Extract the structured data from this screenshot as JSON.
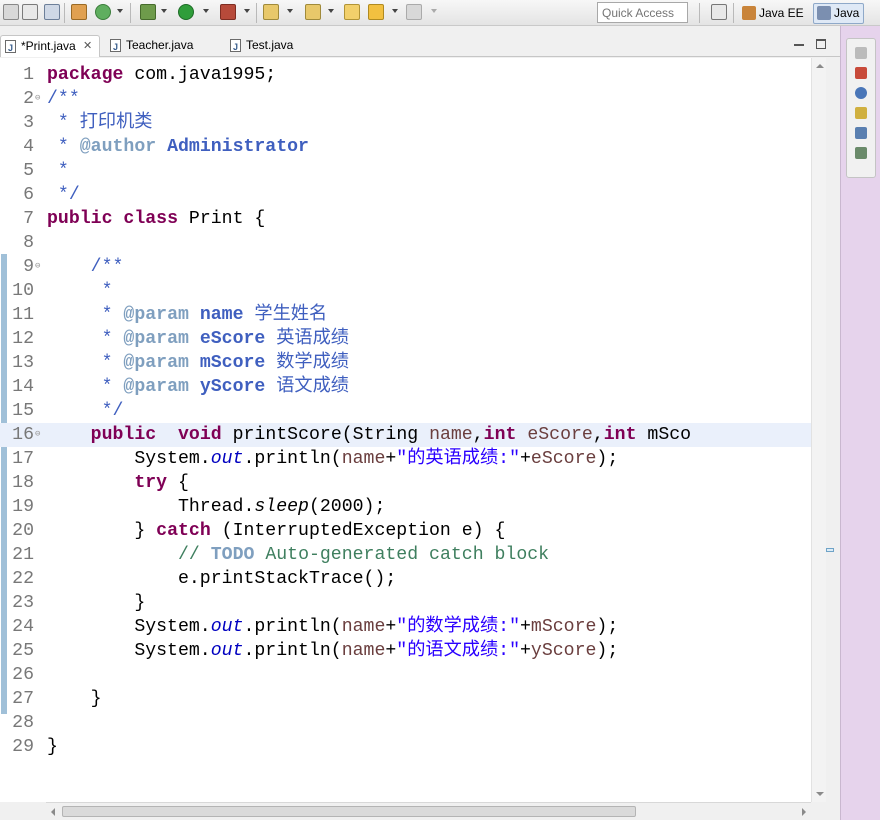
{
  "toolbar": {
    "quick_access_placeholder": "Quick Access",
    "perspectives": [
      {
        "label": "Java EE"
      },
      {
        "label": "Java"
      }
    ]
  },
  "tabs": [
    {
      "label": "*Print.java",
      "active": true
    },
    {
      "label": "Teacher.java",
      "active": false
    },
    {
      "label": "Test.java",
      "active": false
    }
  ],
  "editor": {
    "highlight_line": 16,
    "lines": [
      {
        "n": "1",
        "t": "package com.java1995;"
      },
      {
        "n": "2",
        "t": "/**"
      },
      {
        "n": "3",
        "t": " * 打印机类"
      },
      {
        "n": "4",
        "t": " * @author Administrator"
      },
      {
        "n": "5",
        "t": " *"
      },
      {
        "n": "6",
        "t": " */"
      },
      {
        "n": "7",
        "t": "public class Print {"
      },
      {
        "n": "8",
        "t": ""
      },
      {
        "n": "9",
        "t": "    /**"
      },
      {
        "n": "10",
        "t": "     *"
      },
      {
        "n": "11",
        "t": "     * @param name 学生姓名"
      },
      {
        "n": "12",
        "t": "     * @param eScore 英语成绩"
      },
      {
        "n": "13",
        "t": "     * @param mScore 数学成绩"
      },
      {
        "n": "14",
        "t": "     * @param yScore 语文成绩"
      },
      {
        "n": "15",
        "t": "     */"
      },
      {
        "n": "16",
        "t": "    public  void printScore(String name,int eScore,int mSco"
      },
      {
        "n": "17",
        "t": "        System.out.println(name+\"的英语成绩:\"+eScore);"
      },
      {
        "n": "18",
        "t": "        try {"
      },
      {
        "n": "19",
        "t": "            Thread.sleep(2000);"
      },
      {
        "n": "20",
        "t": "        } catch (InterruptedException e) {"
      },
      {
        "n": "21",
        "t": "            // TODO Auto-generated catch block"
      },
      {
        "n": "22",
        "t": "            e.printStackTrace();"
      },
      {
        "n": "23",
        "t": "        }"
      },
      {
        "n": "24",
        "t": "        System.out.println(name+\"的数学成绩:\"+mScore);"
      },
      {
        "n": "25",
        "t": "        System.out.println(name+\"的语文成绩:\"+yScore);"
      },
      {
        "n": "26",
        "t": ""
      },
      {
        "n": "27",
        "t": "    }"
      },
      {
        "n": "28",
        "t": ""
      },
      {
        "n": "29",
        "t": "}"
      }
    ]
  },
  "colors": {
    "keyword": "#7f0055",
    "javadoc": "#3f5fbf",
    "string": "#2a00ff",
    "comment": "#3f7f5f",
    "field": "#0000c0",
    "current_line": "#eaf0fb",
    "side_panel": "#e6d3ec"
  }
}
